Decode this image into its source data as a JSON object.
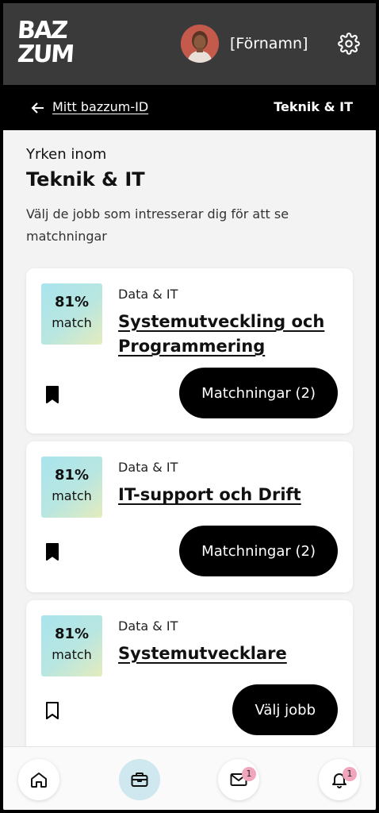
{
  "header": {
    "logo_line1": "BAZ",
    "logo_line2": "ZUM",
    "username": "[Förnamn]"
  },
  "subheader": {
    "back_label": "Mitt bazzum-ID",
    "section": "Teknik & IT"
  },
  "intro": {
    "eyebrow": "Yrken inom",
    "title": "Teknik & IT",
    "description": "Välj de jobb som intresserar dig för att se matchningar"
  },
  "jobs": [
    {
      "match_pct": "81%",
      "match_word": "match",
      "category": "Data & IT",
      "title": "Systemutveckling och Programmering",
      "action": "Matchningar (2)",
      "saved": true
    },
    {
      "match_pct": "81%",
      "match_word": "match",
      "category": "Data & IT",
      "title": "IT-support och Drift",
      "action": "Matchningar (2)",
      "saved": true
    },
    {
      "match_pct": "81%",
      "match_word": "match",
      "category": "Data & IT",
      "title": "Systemutvecklare",
      "action": "Välj jobb",
      "saved": false
    }
  ],
  "bottom_nav": {
    "messages_badge": "1",
    "notifications_badge": "1"
  },
  "colors": {
    "header_bg": "#3a3a3a",
    "subheader_bg": "#000000",
    "page_bg": "#f3f3f3",
    "button_bg": "#000000",
    "badge_pink": "#f2a6bd",
    "nav_active": "#cfe8ef"
  }
}
